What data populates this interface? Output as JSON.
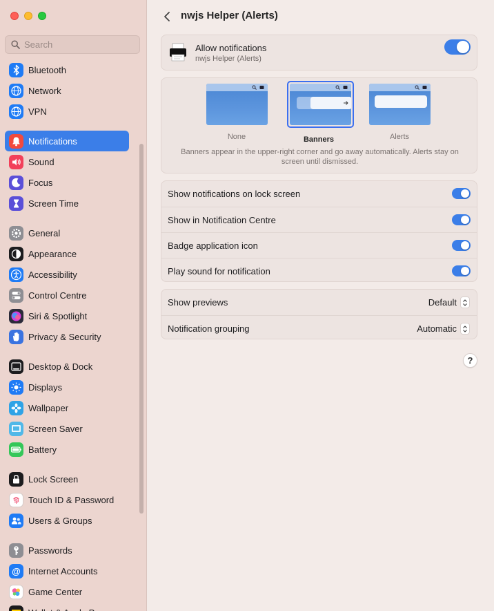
{
  "window": {
    "traffic_lights": [
      "close",
      "minimize",
      "maximize"
    ]
  },
  "sidebar": {
    "search_placeholder": "Search",
    "groups": [
      [
        {
          "label": "Bluetooth",
          "icon": "bluetooth-icon",
          "color": "#1f7bf5"
        },
        {
          "label": "Network",
          "icon": "network-icon",
          "color": "#1f7bf5"
        },
        {
          "label": "VPN",
          "icon": "vpn-icon",
          "color": "#1f7bf5"
        }
      ],
      [
        {
          "label": "Notifications",
          "icon": "notifications-icon",
          "color": "#f24a3d",
          "active": true
        },
        {
          "label": "Sound",
          "icon": "sound-icon",
          "color": "#f2405a"
        },
        {
          "label": "Focus",
          "icon": "focus-icon",
          "color": "#5b4fd8"
        },
        {
          "label": "Screen Time",
          "icon": "screen-time-icon",
          "color": "#5b4fd8"
        }
      ],
      [
        {
          "label": "General",
          "icon": "general-icon",
          "color": "#8e8e93"
        },
        {
          "label": "Appearance",
          "icon": "appearance-icon",
          "color": "#1c1c1e"
        },
        {
          "label": "Accessibility",
          "icon": "accessibility-icon",
          "color": "#1f7bf5"
        },
        {
          "label": "Control Centre",
          "icon": "control-centre-icon",
          "color": "#8e8e93"
        },
        {
          "label": "Siri & Spotlight",
          "icon": "siri-icon",
          "color": "#2b2b3a"
        },
        {
          "label": "Privacy & Security",
          "icon": "privacy-hand-icon",
          "color": "#3a73e0"
        }
      ],
      [
        {
          "label": "Desktop & Dock",
          "icon": "desktop-dock-icon",
          "color": "#1c1c1e"
        },
        {
          "label": "Displays",
          "icon": "displays-icon",
          "color": "#1f7bf5"
        },
        {
          "label": "Wallpaper",
          "icon": "wallpaper-icon",
          "color": "#2fa3e6"
        },
        {
          "label": "Screen Saver",
          "icon": "screen-saver-icon",
          "color": "#4fb8e8"
        },
        {
          "label": "Battery",
          "icon": "battery-icon",
          "color": "#34c759"
        }
      ],
      [
        {
          "label": "Lock Screen",
          "icon": "lock-screen-icon",
          "color": "#1c1c1e"
        },
        {
          "label": "Touch ID & Password",
          "icon": "fingerprint-icon",
          "color": "#ffffff"
        },
        {
          "label": "Users & Groups",
          "icon": "users-groups-icon",
          "color": "#1f7bf5"
        }
      ],
      [
        {
          "label": "Passwords",
          "icon": "passwords-key-icon",
          "color": "#8e8e93"
        },
        {
          "label": "Internet Accounts",
          "icon": "internet-accounts-icon",
          "color": "#1f7bf5"
        },
        {
          "label": "Game Center",
          "icon": "game-center-icon",
          "color": "#ffffff"
        },
        {
          "label": "Wallet & Apple Pay",
          "icon": "wallet-icon",
          "color": "#1c1c1e"
        }
      ]
    ]
  },
  "header": {
    "title": "nwjs Helper (Alerts)"
  },
  "allow": {
    "title": "Allow notifications",
    "subtitle": "nwjs Helper (Alerts)",
    "enabled": true
  },
  "alert_style": {
    "options": [
      {
        "label": "None",
        "selected": false
      },
      {
        "label": "Banners",
        "selected": true
      },
      {
        "label": "Alerts",
        "selected": false
      }
    ],
    "description": "Banners appear in the upper-right corner and go away automatically. Alerts stay on screen until dismissed."
  },
  "toggles": [
    {
      "label": "Show notifications on lock screen",
      "on": true
    },
    {
      "label": "Show in Notification Centre",
      "on": true
    },
    {
      "label": "Badge application icon",
      "on": true
    },
    {
      "label": "Play sound for notification",
      "on": true
    }
  ],
  "selects": [
    {
      "label": "Show previews",
      "value": "Default"
    },
    {
      "label": "Notification grouping",
      "value": "Automatic"
    }
  ],
  "help_label": "?",
  "colors": {
    "accent": "#3b7ee8",
    "sidebar_bg": "#ecd5cf",
    "main_bg": "#f3ebe8"
  }
}
